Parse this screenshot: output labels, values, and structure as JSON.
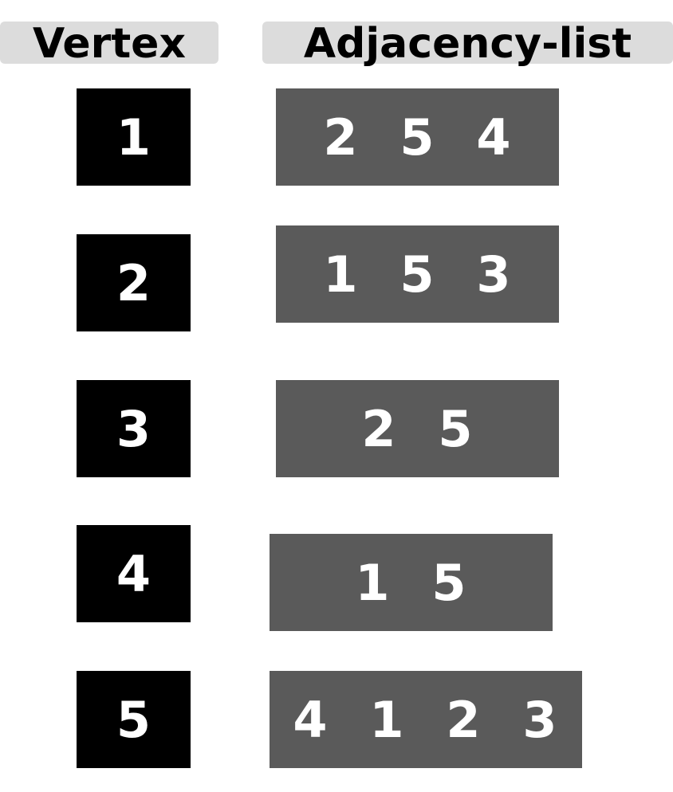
{
  "headers": {
    "vertex": "Vertex",
    "adjacency": "Adjacency-list"
  },
  "colors": {
    "header_bg": "#dcdcdc",
    "vertex_bg": "#000000",
    "adj_bg": "#5a5a5a",
    "text_light": "#ffffff"
  },
  "rows": [
    {
      "vertex": "1",
      "adjacent": [
        "2",
        "5",
        "4"
      ]
    },
    {
      "vertex": "2",
      "adjacent": [
        "1",
        "5",
        "3"
      ]
    },
    {
      "vertex": "3",
      "adjacent": [
        "2",
        "5"
      ]
    },
    {
      "vertex": "4",
      "adjacent": [
        "1",
        "5"
      ]
    },
    {
      "vertex": "5",
      "adjacent": [
        "4",
        "1",
        "2",
        "3"
      ]
    }
  ]
}
